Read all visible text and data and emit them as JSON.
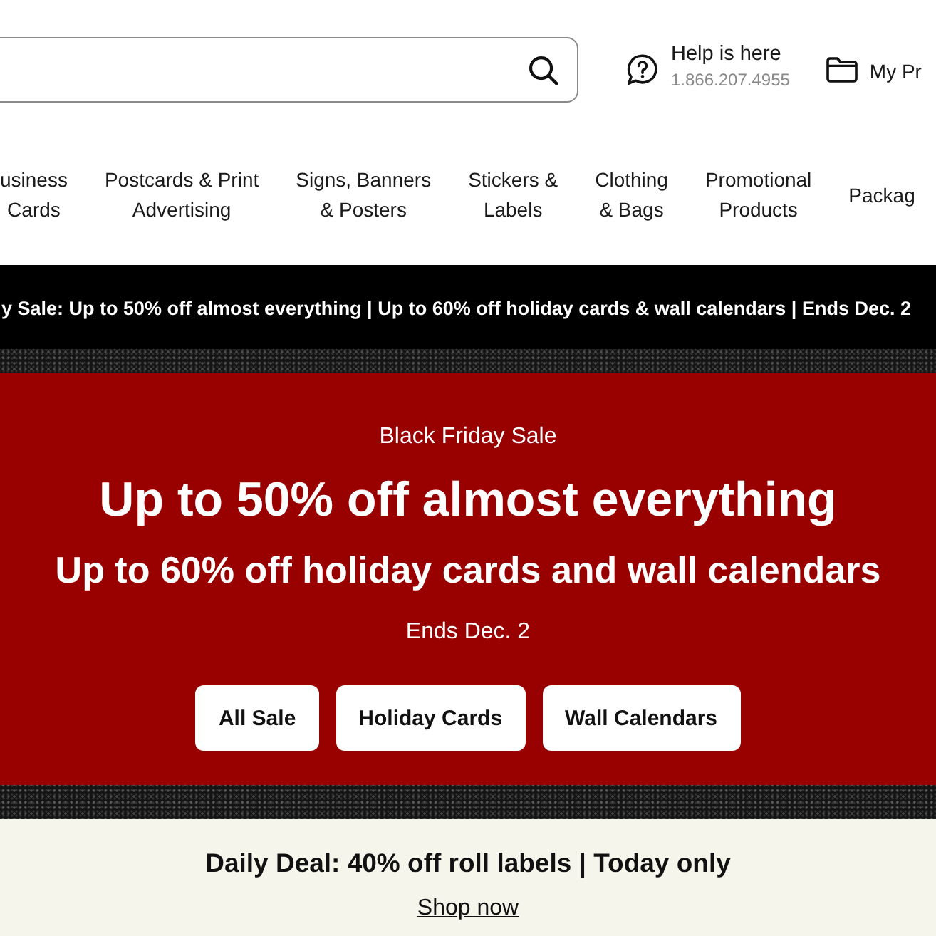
{
  "header": {
    "help": {
      "label": "Help is here",
      "phone": "1.866.207.4955"
    },
    "account_link": "My Pr"
  },
  "nav": [
    {
      "label": "usiness\nCards"
    },
    {
      "label": "Postcards & Print\nAdvertising"
    },
    {
      "label": "Signs, Banners\n& Posters"
    },
    {
      "label": "Stickers &\nLabels"
    },
    {
      "label": "Clothing\n& Bags"
    },
    {
      "label": "Promotional\nProducts"
    },
    {
      "label": "Packag"
    }
  ],
  "ticker": "y Sale: Up to 50% off almost everything | Up to 60% off holiday cards & wall calendars | Ends Dec. 2",
  "hero": {
    "eyebrow": "Black Friday Sale",
    "headline": "Up to 50% off almost everything",
    "subheadline": "Up to 60% off holiday cards and wall calendars",
    "note": "Ends Dec. 2",
    "buttons": [
      "All Sale",
      "Holiday Cards",
      "Wall Calendars"
    ]
  },
  "daily_deal": {
    "text": "Daily Deal: 40% off roll labels | Today only",
    "link": "Shop now"
  }
}
